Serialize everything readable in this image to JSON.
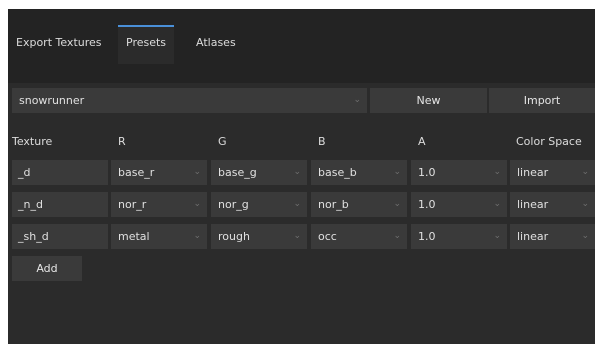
{
  "tabs": [
    {
      "label": "Export Textures"
    },
    {
      "label": "Presets"
    },
    {
      "label": "Atlases"
    }
  ],
  "preset": {
    "selected": "snowrunner",
    "new_label": "New",
    "import_label": "Import"
  },
  "table": {
    "headers": [
      "Texture",
      "R",
      "G",
      "B",
      "A",
      "Color Space"
    ],
    "rows": [
      {
        "texture": "_d",
        "r": "base_r",
        "g": "base_g",
        "b": "base_b",
        "a": "1.0",
        "cs": "linear"
      },
      {
        "texture": "_n_d",
        "r": "nor_r",
        "g": "nor_g",
        "b": "nor_b",
        "a": "1.0",
        "cs": "linear"
      },
      {
        "texture": "_sh_d",
        "r": "metal",
        "g": "rough",
        "b": "occ",
        "a": "1.0",
        "cs": "linear"
      }
    ]
  },
  "add_label": "Add",
  "colors": {
    "panel": "#2b2b2b",
    "tabbar": "#232323",
    "control": "#3a3a3a",
    "accent": "#4a90d9"
  }
}
